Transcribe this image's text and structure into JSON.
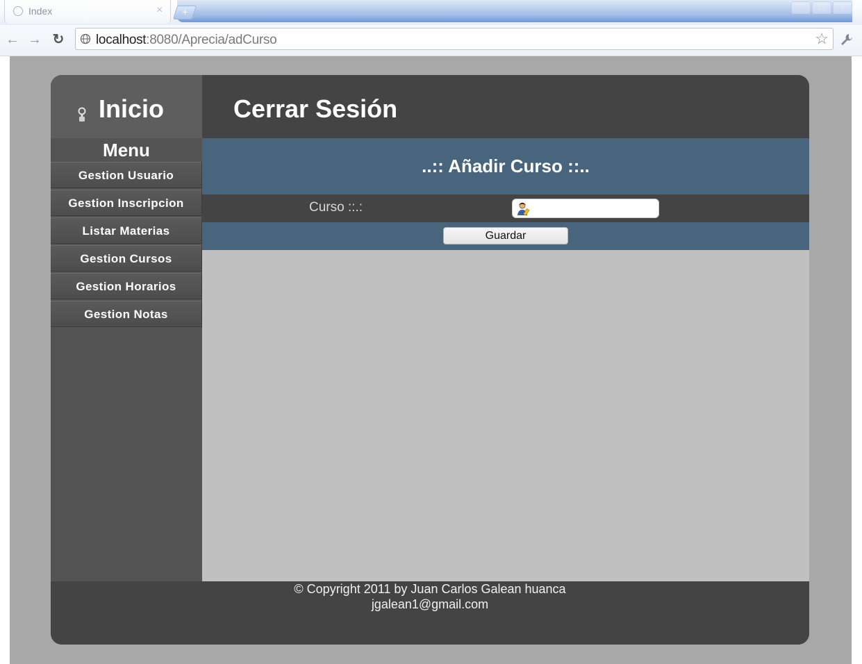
{
  "browser": {
    "tab_title": "Index",
    "tab_close": "×",
    "new_tab": "+",
    "url_host": "localhost",
    "url_path": ":8080/Aprecia/adCurso"
  },
  "header": {
    "inicio_label": "Inicio",
    "logout_label": "Cerrar Sesión"
  },
  "sidebar": {
    "title": "Menu",
    "items": [
      {
        "label": "Gestion Usuario"
      },
      {
        "label": "Gestion Inscripcion"
      },
      {
        "label": "Listar Materias"
      },
      {
        "label": "Gestion Cursos"
      },
      {
        "label": "Gestion Horarios"
      },
      {
        "label": "Gestion Notas"
      }
    ]
  },
  "form": {
    "title": "..:: Añadir Curso ::..",
    "curso_label": "Curso ::.:",
    "curso_value": "",
    "save_label": "Guardar"
  },
  "footer": {
    "copyright": "© Copyright 2011 by Juan Carlos Galean huanca",
    "email": "jgalean1@gmail.com"
  },
  "icons": {
    "tab_favicon": "globe-icon",
    "back": "arrow-left-icon",
    "forward": "arrow-right-icon",
    "reload": "reload-icon",
    "site": "globe-icon",
    "bookmark": "star-icon",
    "settings": "wrench-icon",
    "inicio": "key-icon",
    "curso_input": "user-edit-icon"
  },
  "colors": {
    "frame": "#444444",
    "sidebar": "#545454",
    "content": "#c0c0c0",
    "form_band": "#48657d"
  }
}
